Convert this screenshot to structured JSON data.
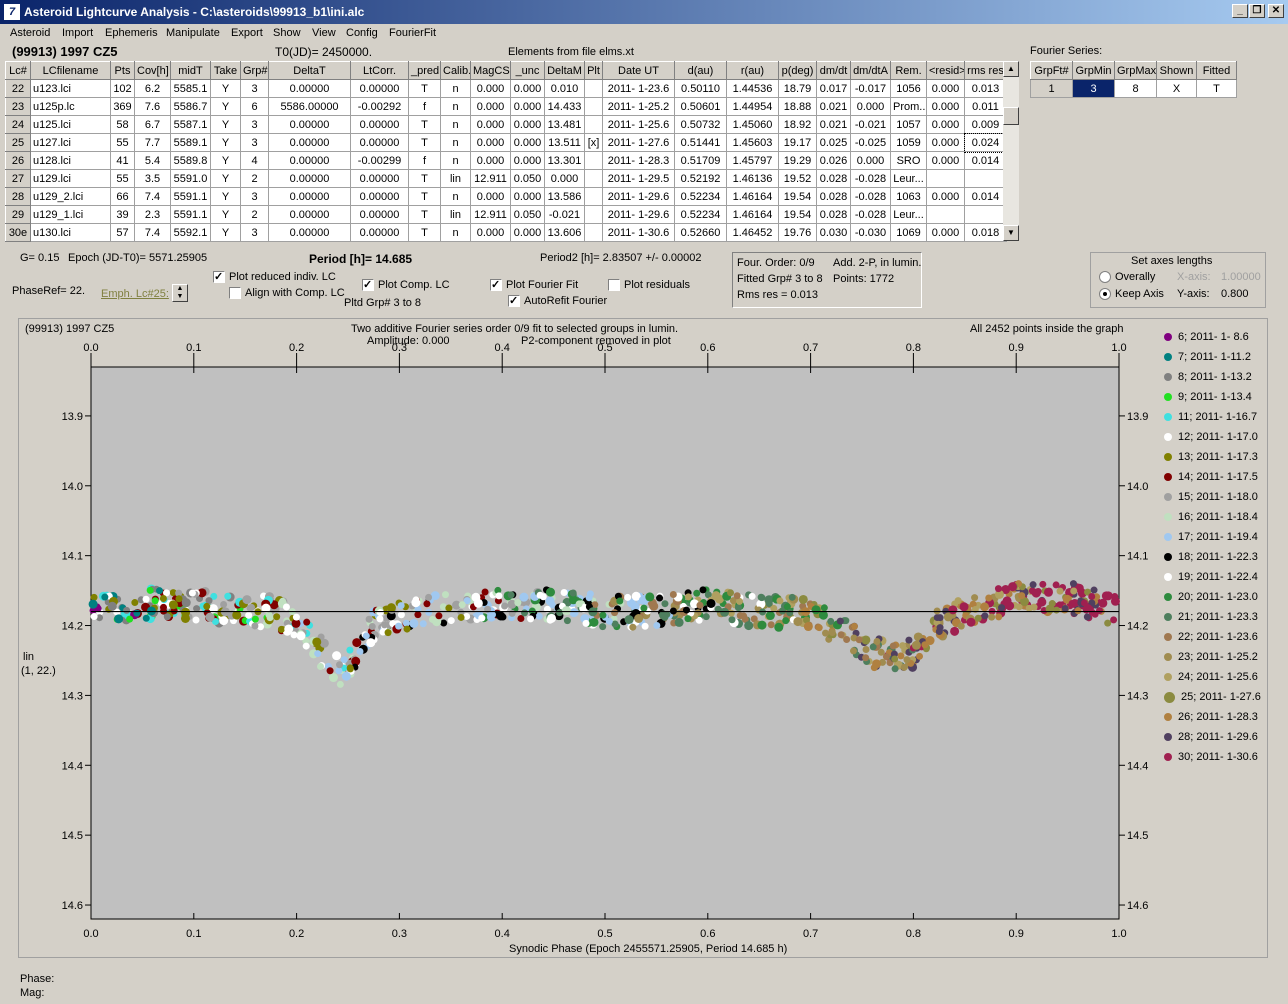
{
  "window": {
    "title": "Asteroid Lightcurve Analysis - C:\\asteroids\\99913_b1\\ini.alc"
  },
  "menu": [
    "Asteroid",
    "Import",
    "Ephemeris",
    "Manipulate",
    "Export",
    "Show",
    "View",
    "Config",
    "FourierFit"
  ],
  "header": {
    "object": "(99913) 1997 CZ5",
    "t0": "T0(JD)= 2450000.",
    "elements": "Elements from file elms.xt"
  },
  "table": {
    "columns": [
      "Lc#",
      "LCfilename",
      "Pts",
      "Cov[h]",
      "midT",
      "Take",
      "Grp#",
      "DeltaT",
      "LtCorr.",
      "_pred",
      "Calib.",
      "MagCS",
      "_unc",
      "DeltaM",
      "Plt",
      "Date UT",
      "d(au)",
      "r(au)",
      "p(deg)",
      "dm/dt",
      "dm/dtA",
      "Rem.",
      "<resid>",
      "rms res"
    ],
    "rows": [
      [
        "22",
        "u123.lci",
        "102",
        "6.2",
        "5585.1",
        "Y",
        "3",
        "0.00000",
        "0.00000",
        "T",
        "n",
        "0.000",
        "0.000",
        "0.010",
        "",
        "2011- 1-23.6",
        "0.50110",
        "1.44536",
        "18.79",
        "0.017",
        "-0.017",
        "1056",
        "0.000",
        "0.013"
      ],
      [
        "23",
        "u125p.lc",
        "369",
        "7.6",
        "5586.7",
        "Y",
        "6",
        "5586.00000",
        "-0.00292",
        "f",
        "n",
        "0.000",
        "0.000",
        "14.433",
        "",
        "2011- 1-25.2",
        "0.50601",
        "1.44954",
        "18.88",
        "0.021",
        "0.000",
        "Prom...",
        "0.000",
        "0.011"
      ],
      [
        "24",
        "u125.lci",
        "58",
        "6.7",
        "5587.1",
        "Y",
        "3",
        "0.00000",
        "0.00000",
        "T",
        "n",
        "0.000",
        "0.000",
        "13.481",
        "",
        "2011- 1-25.6",
        "0.50732",
        "1.45060",
        "18.92",
        "0.021",
        "-0.021",
        "1057",
        "0.000",
        "0.009"
      ],
      [
        "25",
        "u127.lci",
        "55",
        "7.7",
        "5589.1",
        "Y",
        "3",
        "0.00000",
        "0.00000",
        "T",
        "n",
        "0.000",
        "0.000",
        "13.511",
        "[x]",
        "2011- 1-27.6",
        "0.51441",
        "1.45603",
        "19.17",
        "0.025",
        "-0.025",
        "1059",
        "0.000",
        "0.024"
      ],
      [
        "26",
        "u128.lci",
        "41",
        "5.4",
        "5589.8",
        "Y",
        "4",
        "0.00000",
        "-0.00299",
        "f",
        "n",
        "0.000",
        "0.000",
        "13.301",
        "",
        "2011- 1-28.3",
        "0.51709",
        "1.45797",
        "19.29",
        "0.026",
        "0.000",
        "SRO",
        "0.000",
        "0.014"
      ],
      [
        "27",
        "u129.lci",
        "55",
        "3.5",
        "5591.0",
        "Y",
        "2",
        "0.00000",
        "0.00000",
        "T",
        "lin",
        "12.911",
        "0.050",
        "0.000",
        "",
        "2011- 1-29.5",
        "0.52192",
        "1.46136",
        "19.52",
        "0.028",
        "-0.028",
        "Leur...",
        "",
        ""
      ],
      [
        "28",
        "u129_2.lci",
        "66",
        "7.4",
        "5591.1",
        "Y",
        "3",
        "0.00000",
        "0.00000",
        "T",
        "n",
        "0.000",
        "0.000",
        "13.586",
        "",
        "2011- 1-29.6",
        "0.52234",
        "1.46164",
        "19.54",
        "0.028",
        "-0.028",
        "1063",
        "0.000",
        "0.014"
      ],
      [
        "29",
        "u129_1.lci",
        "39",
        "2.3",
        "5591.1",
        "Y",
        "2",
        "0.00000",
        "0.00000",
        "T",
        "lin",
        "12.911",
        "0.050",
        "-0.021",
        "",
        "2011- 1-29.6",
        "0.52234",
        "1.46164",
        "19.54",
        "0.028",
        "-0.028",
        "Leur...",
        "",
        ""
      ],
      [
        "30e",
        "u130.lci",
        "57",
        "7.4",
        "5592.1",
        "Y",
        "3",
        "0.00000",
        "0.00000",
        "T",
        "n",
        "0.000",
        "0.000",
        "13.606",
        "",
        "2011- 1-30.6",
        "0.52660",
        "1.46452",
        "19.76",
        "0.030",
        "-0.030",
        "1069",
        "0.000",
        "0.018"
      ]
    ]
  },
  "fourier": {
    "title": "Fourier Series:",
    "columns": [
      "GrpFt#",
      "GrpMin",
      "GrpMax",
      "Shown",
      "Fitted"
    ],
    "row": [
      "1",
      "3",
      "8",
      "X",
      "T"
    ]
  },
  "info": {
    "g": "G= 0.15",
    "epoch": "Epoch (JD-T0)= 5571.25905",
    "period": "Period [h]= 14.685",
    "period2": "Period2 [h]= 2.83507 +/- 0.00002",
    "phaseref": "PhaseRef= 22.",
    "emph": "Emph. Lc#25:",
    "pltd": "Pltd Grp#  3  to   8",
    "four_order": "Four. Order:  0/9",
    "add2p": "Add. 2-P, in lumin.",
    "fitted": "Fitted Grp# 3 to 8",
    "points": "Points: 1772",
    "rms": "Rms res     = 0.013"
  },
  "checks": {
    "plot_reduced": {
      "label": "Plot reduced indiv. LC",
      "checked": true
    },
    "align": {
      "label": "Align with Comp. LC",
      "checked": false
    },
    "plot_comp": {
      "label": "Plot Comp. LC",
      "checked": true
    },
    "plot_fourier": {
      "label": "Plot Fourier Fit",
      "checked": true
    },
    "plot_resid": {
      "label": "Plot residuals",
      "checked": false
    },
    "autorefit": {
      "label": "AutoRefit Fourier",
      "checked": true
    }
  },
  "axes_box": {
    "title": "Set axes lengths",
    "overall": "Overally",
    "keep": "Keep Axis",
    "xlab": "X-axis:",
    "xval": "1.00000",
    "ylab": "Y-axis:",
    "yval": "0.800"
  },
  "plot": {
    "title_left": "(99913) 1997 CZ5",
    "title_center1": "Two additive Fourier series order 0/9 fit to selected groups in lumin.",
    "title_center2a": "Amplitude: 0.000",
    "title_center2b": "P2-component removed in plot",
    "title_right": "All 2452 points inside the graph",
    "xlabel": "Synodic Phase (Epoch 2455571.25905, Period 14.685 h)",
    "ylabel1": "lin",
    "ylabel2": "(1, 22.)"
  },
  "status": {
    "phase": "Phase:",
    "mag": "Mag:"
  },
  "chart_data": {
    "type": "scatter",
    "xlim": [
      0.0,
      1.0
    ],
    "ylim": [
      14.62,
      13.83
    ],
    "xticks": [
      "0.0",
      "0.1",
      "0.2",
      "0.3",
      "0.4",
      "0.5",
      "0.6",
      "0.7",
      "0.8",
      "0.9",
      "1.0"
    ],
    "yticks": [
      "13.9",
      "14.0",
      "14.1",
      "14.2",
      "14.3",
      "14.4",
      "14.5",
      "14.6"
    ],
    "fit_line_mag": 14.18,
    "legend": [
      {
        "label": "6; 2011- 1- 8.6",
        "color": "#800080"
      },
      {
        "label": "7; 2011- 1-11.2",
        "color": "#008080"
      },
      {
        "label": "8; 2011- 1-13.2",
        "color": "#808080"
      },
      {
        "label": "9; 2011- 1-13.4",
        "color": "#22e022"
      },
      {
        "label": "11; 2011- 1-16.7",
        "color": "#40e0e0"
      },
      {
        "label": "12; 2011- 1-17.0",
        "color": "#ffffff"
      },
      {
        "label": "13; 2011- 1-17.3",
        "color": "#808000"
      },
      {
        "label": "14; 2011- 1-17.5",
        "color": "#800000"
      },
      {
        "label": "15; 2011- 1-18.0",
        "color": "#a0a0a0"
      },
      {
        "label": "16; 2011- 1-18.4",
        "color": "#c0e0c0"
      },
      {
        "label": "17; 2011- 1-19.4",
        "color": "#a0c8f0"
      },
      {
        "label": "18; 2011- 1-22.3",
        "color": "#000000"
      },
      {
        "label": "19; 2011- 1-22.4",
        "color": "#ffffff"
      },
      {
        "label": "20; 2011- 1-23.0",
        "color": "#2e8b3e"
      },
      {
        "label": "21; 2011- 1-23.3",
        "color": "#4e7f5e"
      },
      {
        "label": "22; 2011- 1-23.6",
        "color": "#a07850"
      },
      {
        "label": "23; 2011- 1-25.2",
        "color": "#a08c50"
      },
      {
        "label": "24; 2011- 1-25.6",
        "color": "#b0a060"
      },
      {
        "label": "25; 2011- 1-27.6",
        "color": "#8b8b40"
      },
      {
        "label": "26; 2011- 1-28.3",
        "color": "#b08040"
      },
      {
        "label": "28; 2011- 1-29.6",
        "color": "#504060"
      },
      {
        "label": "30; 2011- 1-30.6",
        "color": "#a02050"
      }
    ],
    "curve_points": [
      [
        0.0,
        14.18
      ],
      [
        0.05,
        14.17
      ],
      [
        0.1,
        14.17
      ],
      [
        0.15,
        14.18
      ],
      [
        0.18,
        14.18
      ],
      [
        0.21,
        14.21
      ],
      [
        0.23,
        14.25
      ],
      [
        0.245,
        14.27
      ],
      [
        0.26,
        14.23
      ],
      [
        0.28,
        14.19
      ],
      [
        0.33,
        14.18
      ],
      [
        0.4,
        14.17
      ],
      [
        0.45,
        14.17
      ],
      [
        0.5,
        14.18
      ],
      [
        0.55,
        14.18
      ],
      [
        0.6,
        14.17
      ],
      [
        0.65,
        14.18
      ],
      [
        0.7,
        14.18
      ],
      [
        0.72,
        14.2
      ],
      [
        0.75,
        14.23
      ],
      [
        0.78,
        14.25
      ],
      [
        0.8,
        14.24
      ],
      [
        0.82,
        14.2
      ],
      [
        0.85,
        14.18
      ],
      [
        0.9,
        14.16
      ],
      [
        0.95,
        14.16
      ],
      [
        1.0,
        14.18
      ]
    ]
  }
}
